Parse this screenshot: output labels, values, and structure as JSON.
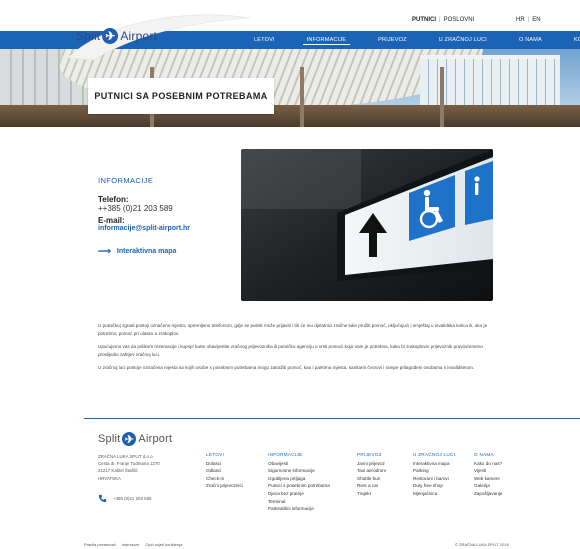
{
  "brand": {
    "name": "Split",
    "mark": "✈",
    "name2": "Airport"
  },
  "topbar": {
    "audience": [
      "PUTNICI",
      "|",
      "POSLOVNI"
    ],
    "languages": [
      "HR",
      "|",
      "EN"
    ]
  },
  "nav": {
    "items": [
      {
        "label": "LETOVI"
      },
      {
        "label": "INFORMACIJE"
      },
      {
        "label": "PRIJEVOZ"
      },
      {
        "label": "U ZRAČNOJ LUCI"
      },
      {
        "label": "O NAMA"
      },
      {
        "label": "KONTAKT"
      }
    ],
    "active": "INFORMACIJE"
  },
  "hero": {
    "title": "PUTNICI SA POSEBNIM POTREBAMA"
  },
  "contact": {
    "section_title": "INFORMACIJE",
    "phone_label": "Telefon:",
    "phone_value": "++385 (0)21 203 589",
    "email_label": "E-mail:",
    "email_value": "informacije@split-airport.hr",
    "map_link": "Interaktivna mapa"
  },
  "body": {
    "paragraphs": [
      "U putničkoj zgradi postoji označeno mjesto, opremljeno telefonom, gdje se putnik može prijaviti i tih će mu djelatnici zračne luke pružiti pomoć, uključujući i smještaj u invalidska kolica ili, ako je potrebno, pomoć pri ulasku u zrakoplov.",
      "Upućujemo vas da prilikom rezervacije i kupnje karte obavijestite zračnog prijevoznika ili putničku agenciju o vrsti pomoći koja Vam je potrebna, kako bi zrakoplovni prijevoznik pravovremeno proslijedio zahtjev zračnoj luci.",
      "U zračnoj luci postoje označena mjesta sa kojih osobe s posebnim potrebama mogu zatražiti pomoć, kao i parkirna mjesta, sanitarni čvorovi i rampe prilagođeni osobama s invaliditetom."
    ]
  },
  "footer": {
    "address": [
      "ZRAČNA LUKA SPLIT d.o.o.",
      "Cesta dr. Franje Tuđmana 1270",
      "21217 Kaštel Štafilić",
      "HRVATSKA"
    ],
    "phone": "+385 (0)21 203 555",
    "columns": [
      {
        "heading": "LETOVI",
        "items": [
          "Dolasci",
          "Odlasci",
          "Check-in",
          "Zračni prijevoznici"
        ]
      },
      {
        "heading": "INFORMACIJE",
        "items": [
          "Obavijesti",
          "Sigurnosne informacije",
          "Izgubljena prtljaga",
          "Putnici s posebnim potrebama",
          "Djeca bez pratnje",
          "Terminal",
          "Parkirališni informacije"
        ]
      },
      {
        "heading": "PRIJEVOZ",
        "items": [
          "Javni prijevoz",
          "Taxi aerodrom",
          "Shuttle bus",
          "Rent a car",
          "Trajekt"
        ]
      },
      {
        "heading": "U ZRAČNOJ LUCI",
        "items": [
          "Interaktivna mapa",
          "Parking",
          "Restorani i barovi",
          "Duty free shop",
          "Mjenjačnica"
        ]
      },
      {
        "heading": "O NAMA",
        "items": [
          "Kako do nas?",
          "Vijesti",
          "Web kamere",
          "Galerija",
          "Zapošljavanje"
        ]
      }
    ],
    "legal": [
      "Pravila privatnosti",
      "Impresum",
      "Opći uvjeti korištenja"
    ],
    "copyright": "© ZRAČNA LUKA SPLIT 2016"
  },
  "colors": {
    "primary": "#1b63b5",
    "text": "#333333",
    "background": "#ffffff"
  },
  "icons": [
    "phone-icon",
    "arrow-right-icon",
    "wheelchair-icon",
    "arrow-up-icon",
    "logo-plane-icon"
  ]
}
